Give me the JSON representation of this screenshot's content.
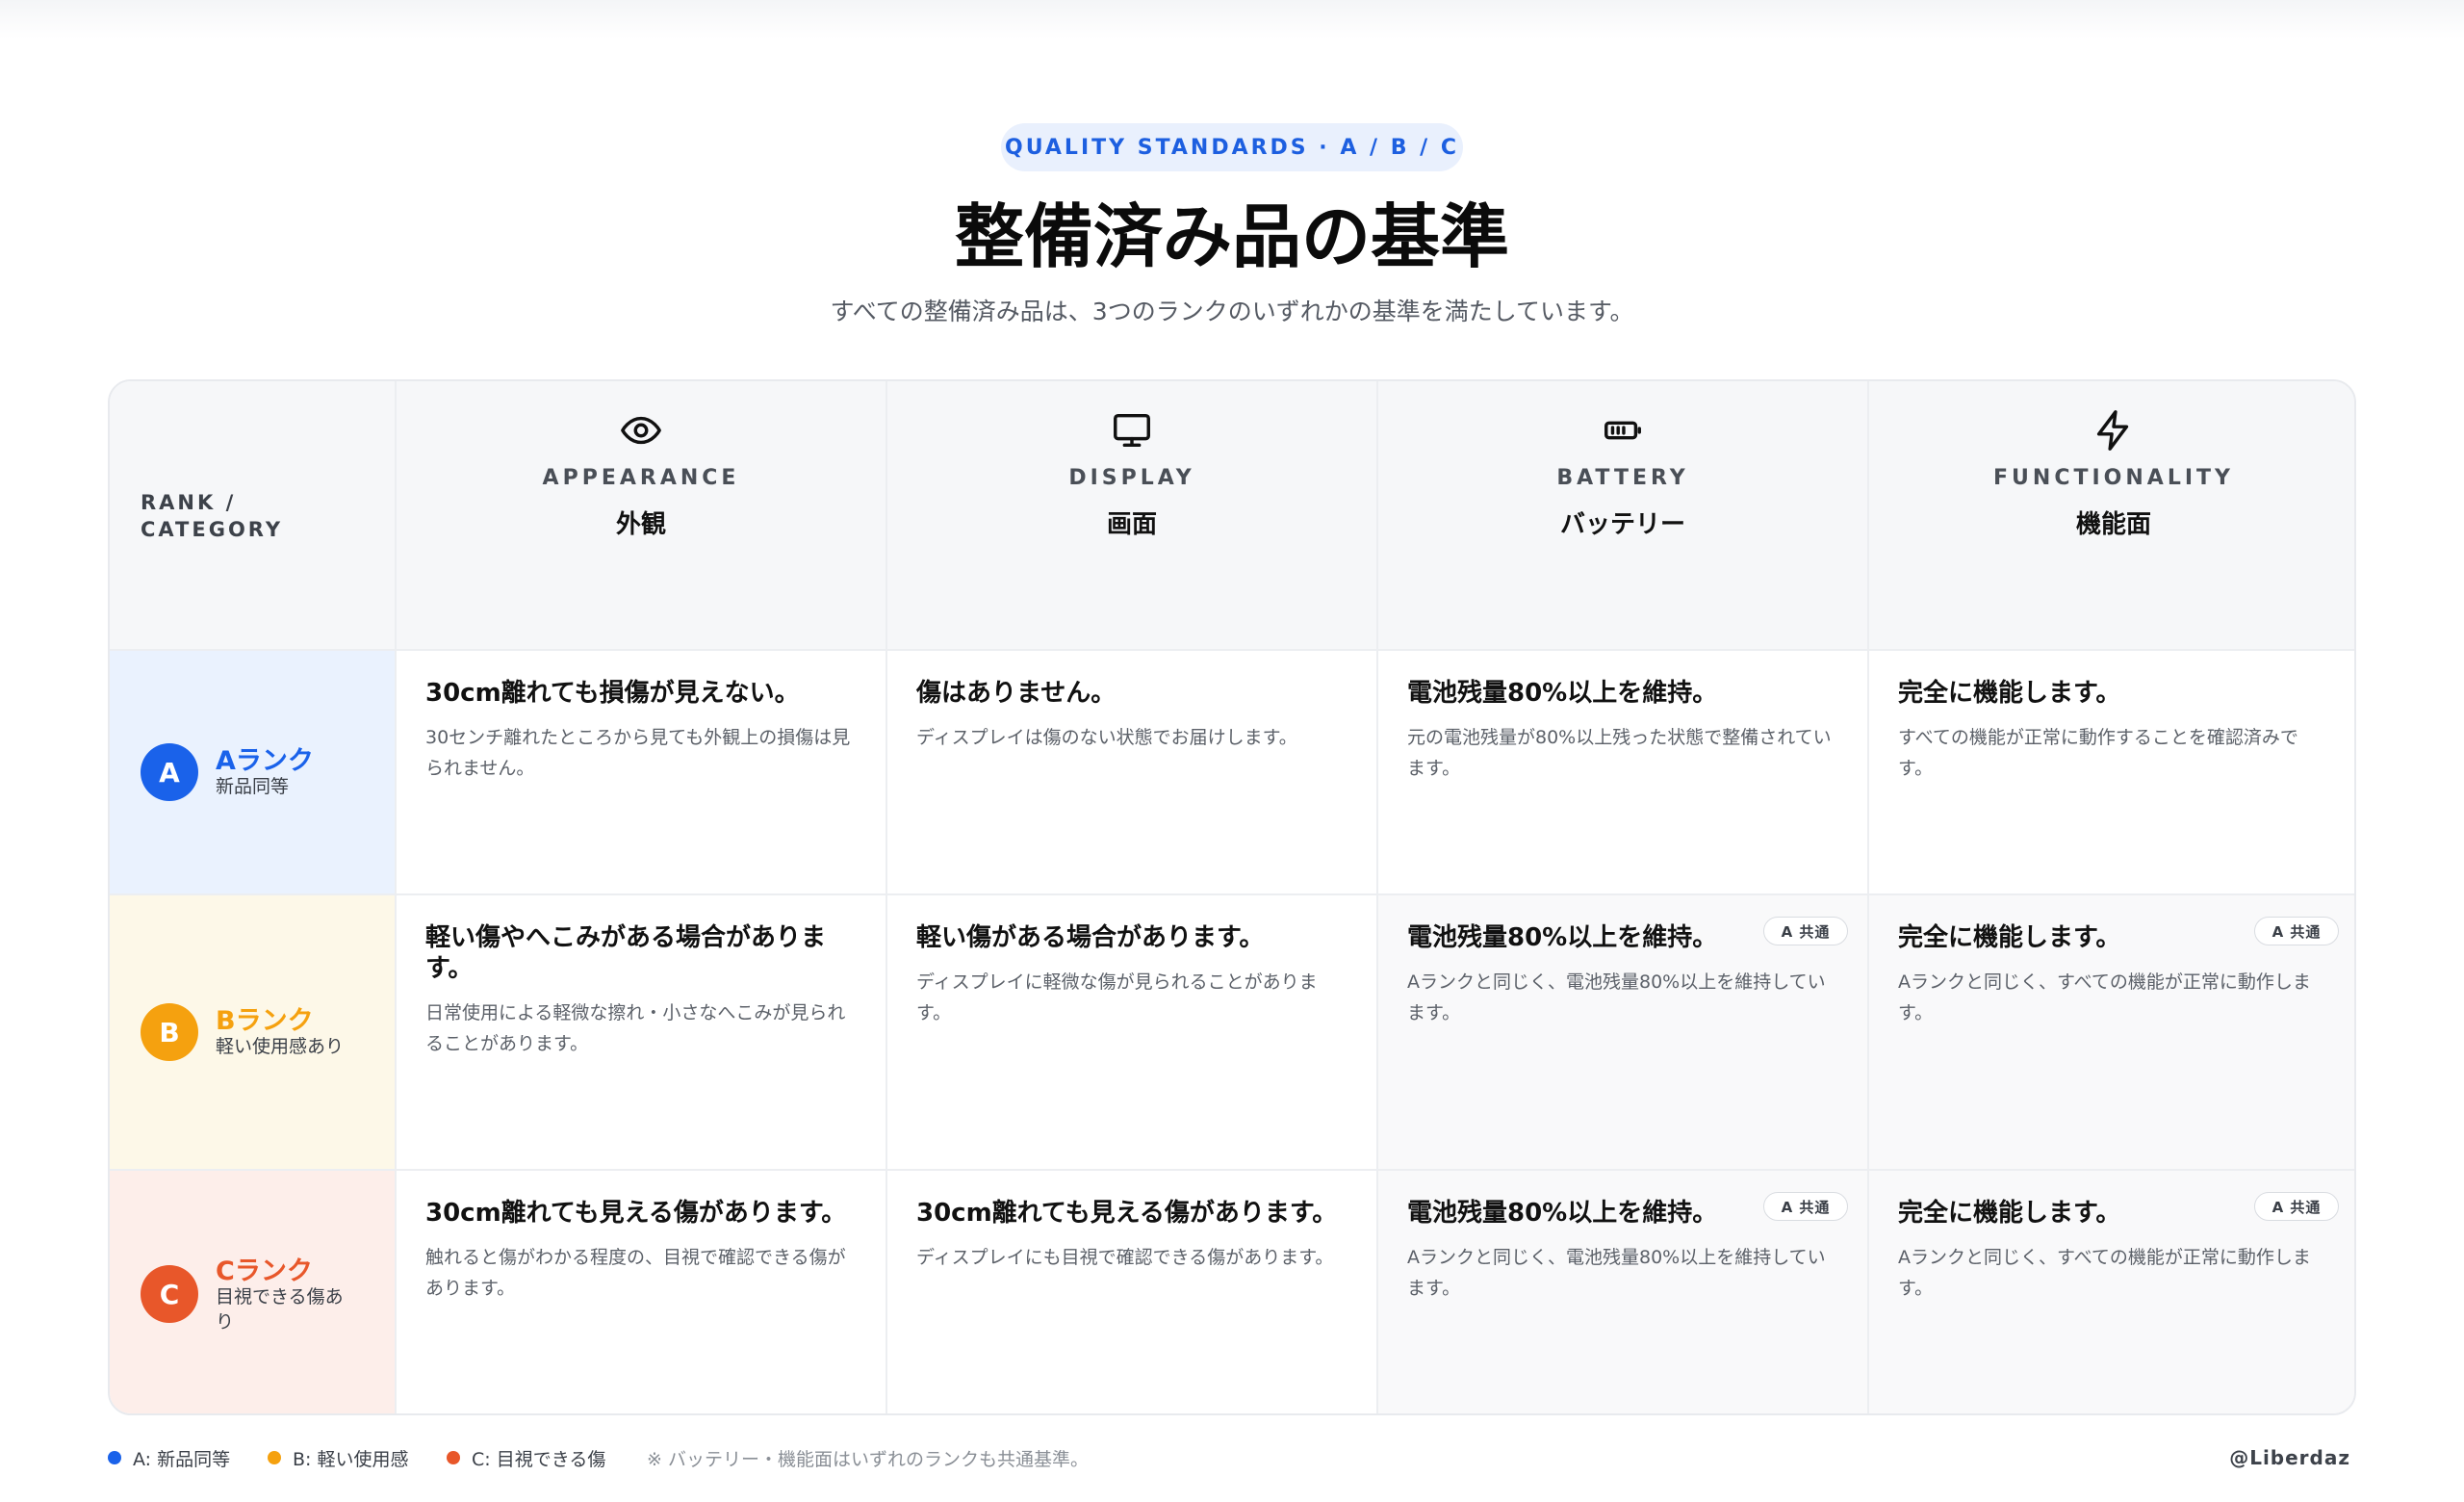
{
  "header": {
    "pill": "QUALITY STANDARDS · A / B / C",
    "title": "整備済み品の基準",
    "subtitle": "すべての整備済み品は、3つのランクのいずれかの基準を満たしています。"
  },
  "table": {
    "corner_label": "RANK / CATEGORY",
    "columns": [
      {
        "icon": "eye-icon",
        "en": "APPEARANCE",
        "jp": "外観"
      },
      {
        "icon": "monitor-icon",
        "en": "DISPLAY",
        "jp": "画面"
      },
      {
        "icon": "battery-icon",
        "en": "BATTERY",
        "jp": "バッテリー"
      },
      {
        "icon": "lightning-icon",
        "en": "FUNCTIONALITY",
        "jp": "機能面"
      }
    ],
    "rows": [
      {
        "letter": "A",
        "name": "Aランク",
        "sub": "新品同等",
        "color": "#1a62ea",
        "bg": "#eaf2fe",
        "cells": [
          {
            "title": "30cm離れても損傷が見えない。",
            "desc": "30センチ離れたところから見ても外観上の損傷は見られません。"
          },
          {
            "title": "傷はありません。",
            "desc": "ディスプレイは傷のない状態でお届けします。"
          },
          {
            "title": "電池残量80%以上を維持。",
            "desc": "元の電池残量が80%以上残った状態で整備されています。"
          },
          {
            "title": "完全に機能します。",
            "desc": "すべての機能が正常に動作することを確認済みです。"
          }
        ]
      },
      {
        "letter": "B",
        "name": "Bランク",
        "sub": "軽い使用感あり",
        "color": "#f5a10f",
        "bg": "#fdf8e8",
        "cells": [
          {
            "title": "軽い傷やへこみがある場合がありま す。",
            "desc": "日常使用による軽微な擦れ・小さなへこみが見られることがあります。"
          },
          {
            "title": "軽い傷がある場合があります。",
            "desc": "ディスプレイに軽微な傷が見られることがあります。"
          },
          {
            "title": "電池残量80%以上を維持。",
            "desc": "Aランクと同じく、電池残量80%以上を維持しています。",
            "tag": "A 共通"
          },
          {
            "title": "完全に機能します。",
            "desc": "Aランクと同じく、すべての機能が正常に動作します。",
            "tag": "A 共通"
          }
        ]
      },
      {
        "letter": "C",
        "name": "Cランク",
        "sub": "目視できる傷あり",
        "color": "#e8572a",
        "bg": "#fdeeea",
        "cells": [
          {
            "title": "30cm離れても見える傷があります。",
            "desc": "触れると傷がわかる程度の、目視で確認できる傷があります。"
          },
          {
            "title": "30cm離れても見える傷があります。",
            "desc": "ディスプレイにも目視で確認できる傷があります。"
          },
          {
            "title": "電池残量80%以上を維持。",
            "desc": "Aランクと同じく、電池残量80%以上を維持しています。",
            "tag": "A 共通"
          },
          {
            "title": "完全に機能します。",
            "desc": "Aランクと同じく、すべての機能が正常に動作します。",
            "tag": "A 共通"
          }
        ]
      }
    ]
  },
  "legend": {
    "items": [
      {
        "label": "A: 新品同等",
        "color": "#1a62ea"
      },
      {
        "label": "B: 軽い使用感",
        "color": "#f5a10f"
      },
      {
        "label": "C: 目視できる傷",
        "color": "#e8572a"
      }
    ],
    "note": "※ バッテリー・機能面はいずれのランクも共通基準。",
    "handle": "@Liberdaz"
  }
}
